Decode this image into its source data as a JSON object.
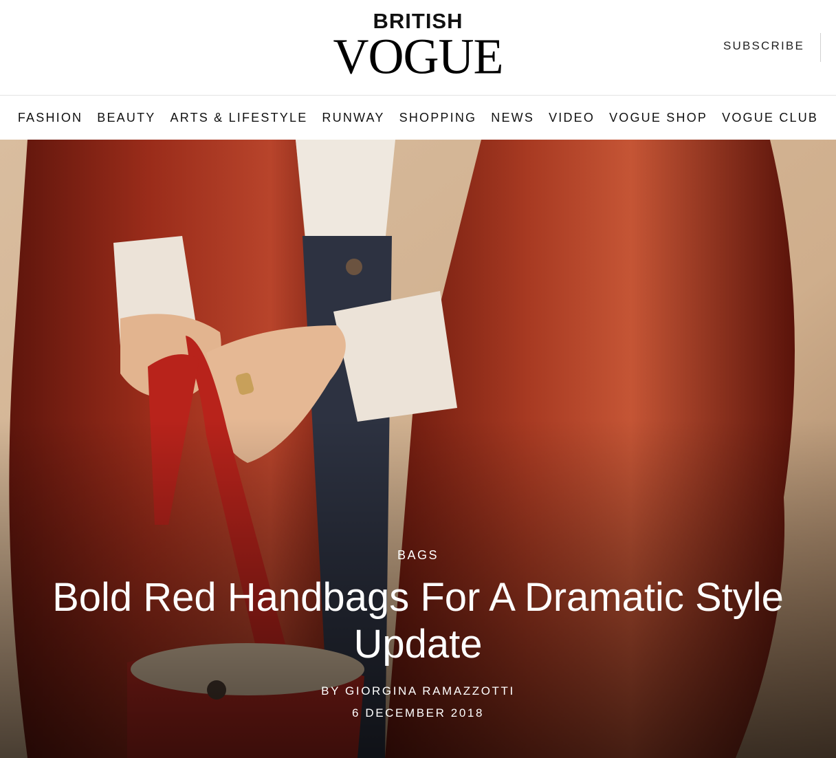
{
  "header": {
    "logo_top": "BRITISH",
    "logo_main": "VOGUE",
    "subscribe_label": "SUBSCRIBE"
  },
  "nav": {
    "items": [
      {
        "label": "FASHION"
      },
      {
        "label": "BEAUTY"
      },
      {
        "label": "ARTS & LIFESTYLE"
      },
      {
        "label": "RUNWAY"
      },
      {
        "label": "SHOPPING"
      },
      {
        "label": "NEWS"
      },
      {
        "label": "VIDEO"
      },
      {
        "label": "VOGUE SHOP"
      },
      {
        "label": "VOGUE CLUB"
      }
    ]
  },
  "hero": {
    "category": "BAGS",
    "headline": "Bold Red Handbags For A Dramatic Style Update",
    "byline": "BY GIORGINA RAMAZZOTTI",
    "date": "6 DECEMBER 2018"
  },
  "colors": {
    "coat_red": "#8e2516",
    "background_beige": "#d4b596",
    "shirt_white": "#efe8df",
    "denim": "#2b2f3a",
    "bag_red": "#b8231b"
  }
}
